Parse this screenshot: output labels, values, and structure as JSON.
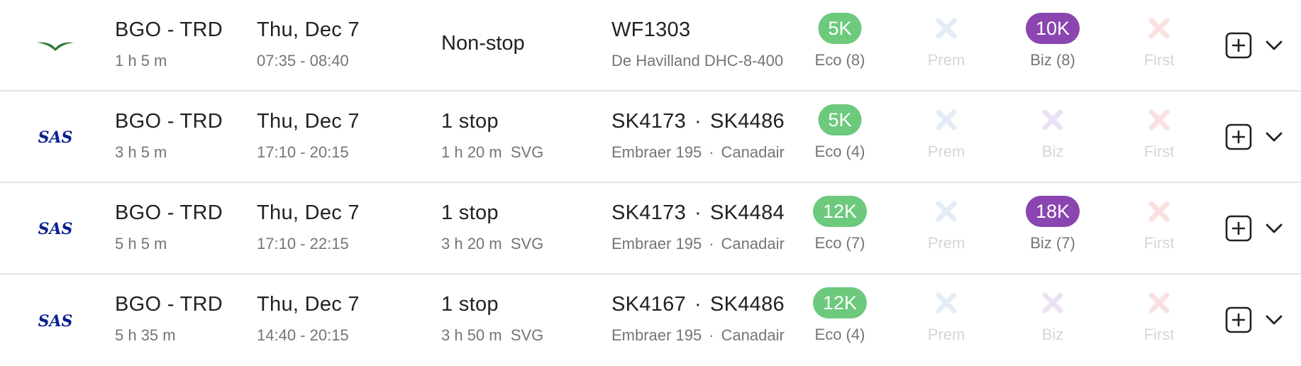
{
  "colors": {
    "eco": "#6dc97c",
    "biz": "#8a45b0",
    "prem_x": "#e3ecf7",
    "biz_x": "#ece1f3",
    "first_x": "#f9e1df",
    "sas_blue": "#0a1f8f",
    "wideroe_green": "#2e7d3a"
  },
  "flights": [
    {
      "airline_logo": "wideroe-logo",
      "route": "BGO - TRD",
      "duration": "1 h 5 m",
      "date": "Thu, Dec 7",
      "time": "07:35 - 08:40",
      "stops": "Non-stop",
      "stop_detail": "",
      "flight_numbers": [
        "WF1303"
      ],
      "aircraft": [
        "De Havilland DHC-8-400"
      ],
      "eco": {
        "price": "5K",
        "label": "Eco (8)"
      },
      "prem": {
        "label": "Prem"
      },
      "biz": {
        "price": "10K",
        "label": "Biz (8)"
      },
      "first": {
        "label": "First"
      }
    },
    {
      "airline_logo": "SAS",
      "route": "BGO - TRD",
      "duration": "3 h 5 m",
      "date": "Thu, Dec 7",
      "time": "17:10 - 20:15",
      "stops": "1 stop",
      "stop_detail": "1 h 20 m  SVG",
      "flight_numbers": [
        "SK4173",
        "SK4486"
      ],
      "aircraft": [
        "Embraer 195",
        "Canadair"
      ],
      "eco": {
        "price": "5K",
        "label": "Eco (4)"
      },
      "prem": {
        "label": "Prem"
      },
      "biz": {
        "label": "Biz"
      },
      "first": {
        "label": "First"
      }
    },
    {
      "airline_logo": "SAS",
      "route": "BGO - TRD",
      "duration": "5 h 5 m",
      "date": "Thu, Dec 7",
      "time": "17:10 - 22:15",
      "stops": "1 stop",
      "stop_detail": "3 h 20 m  SVG",
      "flight_numbers": [
        "SK4173",
        "SK4484"
      ],
      "aircraft": [
        "Embraer 195",
        "Canadair"
      ],
      "eco": {
        "price": "12K",
        "label": "Eco (7)"
      },
      "prem": {
        "label": "Prem"
      },
      "biz": {
        "price": "18K",
        "label": "Biz (7)"
      },
      "first": {
        "label": "First"
      }
    },
    {
      "airline_logo": "SAS",
      "route": "BGO - TRD",
      "duration": "5 h 35 m",
      "date": "Thu, Dec 7",
      "time": "14:40 - 20:15",
      "stops": "1 stop",
      "stop_detail": "3 h 50 m  SVG",
      "flight_numbers": [
        "SK4167",
        "SK4486"
      ],
      "aircraft": [
        "Embraer 195",
        "Canadair"
      ],
      "eco": {
        "price": "12K",
        "label": "Eco (4)"
      },
      "prem": {
        "label": "Prem"
      },
      "biz": {
        "label": "Biz"
      },
      "first": {
        "label": "First"
      }
    }
  ],
  "icons": {
    "add": "plus-square-icon",
    "expand": "chevron-down-icon",
    "unavailable": "x-icon"
  }
}
